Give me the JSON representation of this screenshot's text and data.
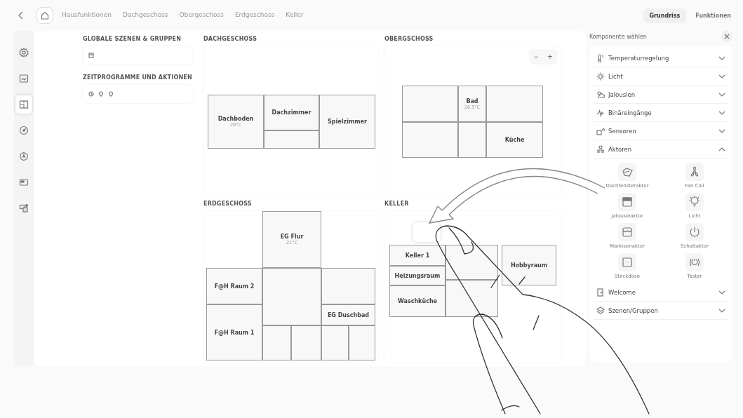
{
  "topbar": {
    "tabs": [
      {
        "label": "Hausfunktionen",
        "selected": false
      },
      {
        "label": "Dachgeschoss",
        "selected": false
      },
      {
        "label": "Obergeschoss",
        "selected": false
      },
      {
        "label": "Erdgeschoss",
        "selected": false
      },
      {
        "label": "Keller",
        "selected": false
      }
    ],
    "view_toggle": [
      {
        "label": "Grundriss",
        "selected": true
      },
      {
        "label": "Funktionen",
        "selected": false
      }
    ]
  },
  "sidebar": {
    "items": [
      {
        "selected": false
      },
      {
        "selected": false
      },
      {
        "selected": true
      },
      {
        "selected": false
      },
      {
        "selected": false
      },
      {
        "selected": false
      },
      {
        "selected": false
      }
    ]
  },
  "sections": [
    {
      "title": "GLOBALE SZENEN & GRUPPEN"
    },
    {
      "title": "ZEITPROGRAMME UND AKTIONEN"
    }
  ],
  "floors": [
    {
      "title": "DACHGESCHOSS",
      "rooms": [
        {
          "name": "Dachboden",
          "temperature": "20°C"
        },
        {
          "name": "Dachzimmer"
        },
        {
          "name": "Spielzimmer"
        }
      ]
    },
    {
      "title": "OBERGSCHOSS",
      "zoom_out": "−",
      "zoom_in": "+",
      "rooms": [
        {
          "name": "Bad",
          "temperature": "20.5°C"
        },
        {
          "name": "Küche"
        }
      ]
    },
    {
      "title": "ERDGESCHOSS",
      "rooms": [
        {
          "name": "EG Flur",
          "temperature": "21°C"
        },
        {
          "name": "F@H Raum 2"
        },
        {
          "name": "EG Duschbad"
        },
        {
          "name": "F@H Raum 1"
        }
      ]
    },
    {
      "title": "KELLER",
      "rooms": [
        {
          "name": "Keller 1"
        },
        {
          "name": "Hobbyraum"
        },
        {
          "name": "Heizungsraum"
        },
        {
          "name": "Waschküche"
        }
      ]
    }
  ],
  "component_panel": {
    "title": "Komponente wählen",
    "categories": [
      {
        "label": "Temperaturregelung",
        "expanded": false
      },
      {
        "label": "Licht",
        "expanded": false
      },
      {
        "label": "Jalousien",
        "expanded": false
      },
      {
        "label": "Binäreingänge",
        "expanded": false
      },
      {
        "label": "Sensoren",
        "expanded": false
      },
      {
        "label": "Aktoren",
        "expanded": true,
        "components": [
          {
            "label": "Dachfensteraktor"
          },
          {
            "label": "Fan Coil"
          },
          {
            "label": "Jalousieaktor"
          },
          {
            "label": "Licht"
          },
          {
            "label": "Markisenaktor"
          },
          {
            "label": "Schaltaktor"
          },
          {
            "label": "Steckdose"
          },
          {
            "label": "Taster"
          }
        ]
      },
      {
        "label": "Welcome",
        "expanded": false
      },
      {
        "label": "Szenen/Gruppen",
        "expanded": false
      }
    ]
  }
}
